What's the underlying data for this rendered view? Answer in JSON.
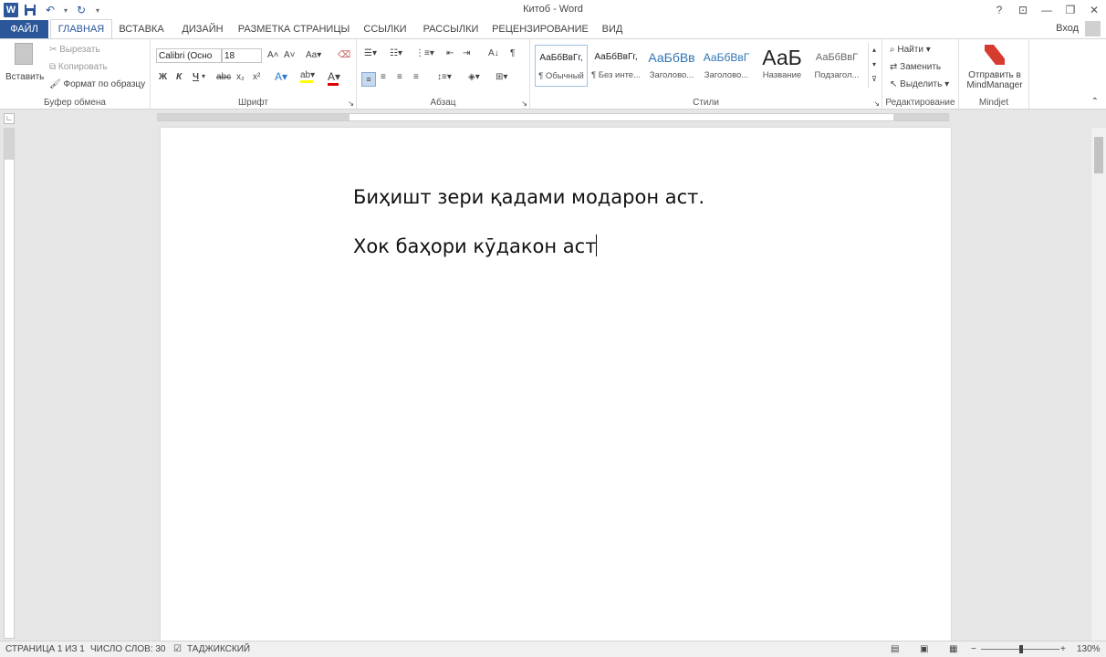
{
  "app": {
    "title": "Китоб - Word",
    "signin": "Вход"
  },
  "tabs": [
    {
      "label": "ФАЙЛ"
    },
    {
      "label": "ГЛАВНАЯ"
    },
    {
      "label": "ВСТАВКА"
    },
    {
      "label": "ДИЗАЙН"
    },
    {
      "label": "РАЗМЕТКА СТРАНИЦЫ"
    },
    {
      "label": "ССЫЛКИ"
    },
    {
      "label": "РАССЫЛКИ"
    },
    {
      "label": "РЕЦЕНЗИРОВАНИЕ"
    },
    {
      "label": "ВИД"
    }
  ],
  "clipboard": {
    "paste": "Вставить",
    "cut": "Вырезать",
    "copy": "Копировать",
    "format_painter": "Формат по образцу",
    "label": "Буфер обмена"
  },
  "font": {
    "name": "Calibri (Осно",
    "size": "18",
    "label": "Шрифт"
  },
  "paragraph": {
    "label": "Абзац"
  },
  "styles": {
    "items": [
      {
        "preview": "АаБбВвГг,",
        "name": "¶ Обычный"
      },
      {
        "preview": "АаБбВвГг,",
        "name": "¶ Без инте..."
      },
      {
        "preview": "АаБбВв",
        "name": "Заголово..."
      },
      {
        "preview": "АаБбВвГ",
        "name": "Заголово..."
      },
      {
        "preview": "АаБ",
        "name": "Название"
      },
      {
        "preview": "АаБбВвГ",
        "name": "Подзагол..."
      }
    ],
    "label": "Стили"
  },
  "editing": {
    "find": "Найти",
    "replace": "Заменить",
    "select": "Выделить",
    "label": "Редактирование"
  },
  "mindjet": {
    "send": "Отправить в",
    "send2": "MindManager",
    "label": "Mindjet"
  },
  "document": {
    "lines": [
      "Биҳишт зери қадами модарон аст.",
      "Хок баҳори кӯдакон аст"
    ]
  },
  "status": {
    "page": "СТРАНИЦА 1 ИЗ 1",
    "words": "ЧИСЛО СЛОВ: 30",
    "language": "ТАДЖИКСКИЙ",
    "zoom": "130%"
  },
  "colors": {
    "accent": "#2b579a",
    "font_color_bar": "#e00000",
    "highlight_bar": "#ffff00"
  }
}
